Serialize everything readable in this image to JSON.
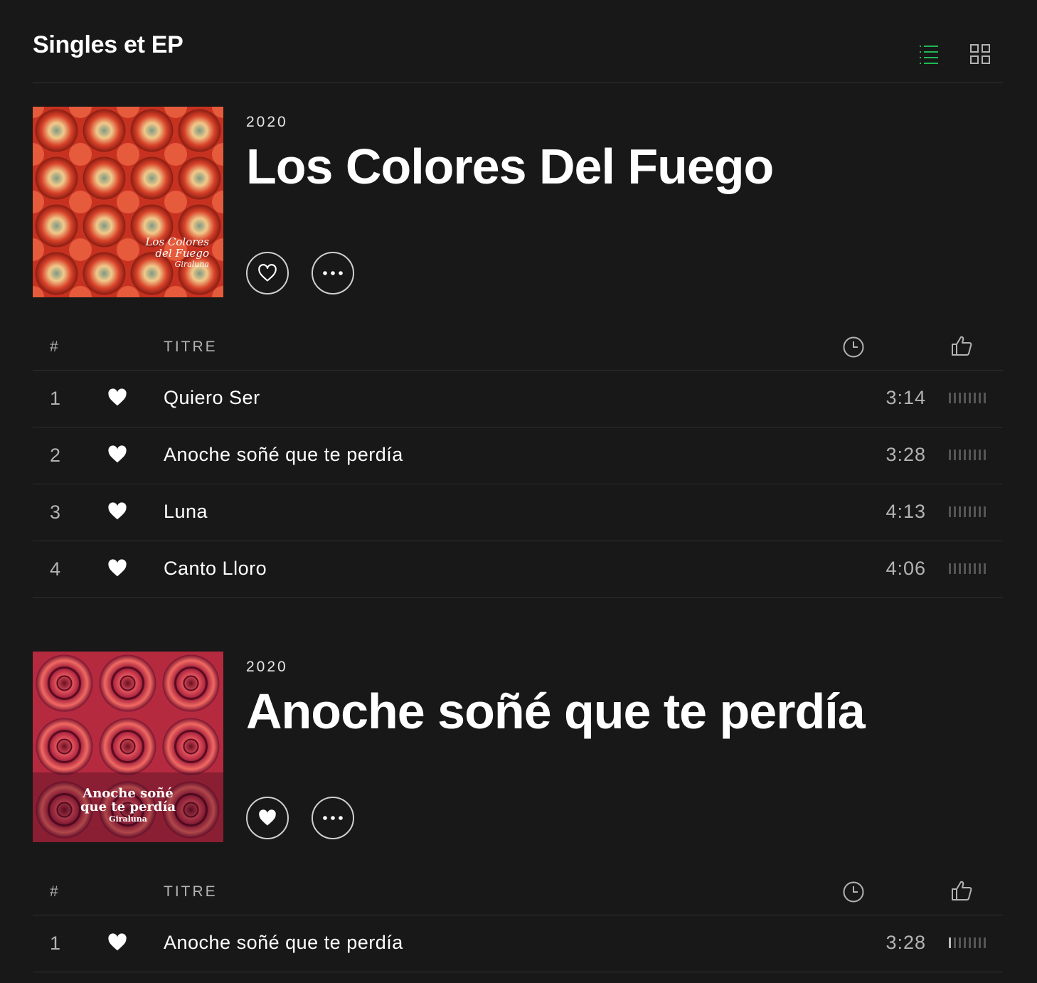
{
  "section": {
    "title": "Singles et EP"
  },
  "view_toggle": {
    "list_icon": "list-icon",
    "grid_icon": "grid-icon",
    "active": "list",
    "active_color": "#1db954"
  },
  "albums": [
    {
      "year": "2020",
      "title": "Los Colores Del Fuego",
      "liked": false,
      "cover": {
        "line1": "Los Colores",
        "line2": "del Fuego",
        "line3": "Giraluna"
      },
      "header": {
        "num": "#",
        "title": "TITRE"
      },
      "tracks": [
        {
          "num": "1",
          "title": "Quiero Ser",
          "duration": "3:14",
          "popularity": 0
        },
        {
          "num": "2",
          "title": "Anoche soñé que te perdía",
          "duration": "3:28",
          "popularity": 0
        },
        {
          "num": "3",
          "title": "Luna",
          "duration": "4:13",
          "popularity": 0
        },
        {
          "num": "4",
          "title": "Canto Lloro",
          "duration": "4:06",
          "popularity": 0
        }
      ]
    },
    {
      "year": "2020",
      "title": "Anoche soñé que te perdía",
      "liked": true,
      "cover": {
        "line1": "Anoche soñé",
        "line2": "que te perdía",
        "line3": "Giraluna"
      },
      "header": {
        "num": "#",
        "title": "TITRE"
      },
      "tracks": [
        {
          "num": "1",
          "title": "Anoche soñé que te perdía",
          "duration": "3:28",
          "popularity": 0.125
        }
      ]
    }
  ]
}
